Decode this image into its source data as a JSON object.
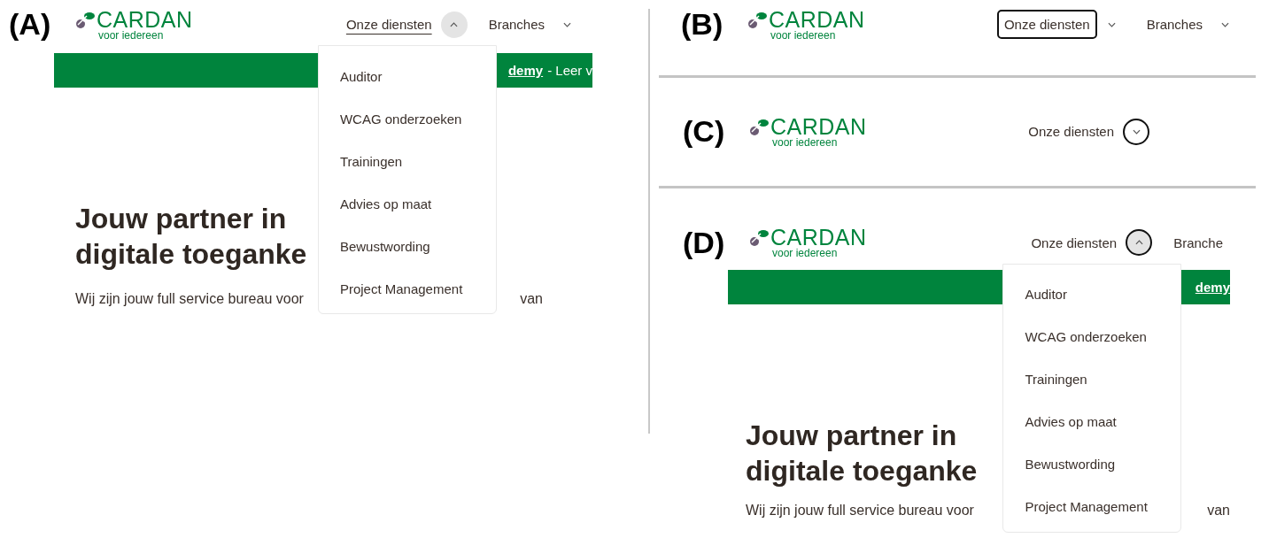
{
  "panels": [
    {
      "label": "(A)",
      "logo": {
        "name": "CARDAN",
        "tagline": "voor iedereen"
      },
      "nav": [
        {
          "label": "Onze diensten",
          "underlined": true,
          "expanded": true,
          "label_focused": false,
          "toggle_focused": false,
          "menu": [
            "Auditor",
            "WCAG onderzoeken",
            "Trainingen",
            "Advies op maat",
            "Bewustwording",
            "Project Management"
          ]
        },
        {
          "label": "Branches",
          "underlined": false,
          "expanded": false,
          "label_focused": false,
          "toggle_focused": false
        }
      ],
      "banner": {
        "link": "demy",
        "text": "- Leer v"
      },
      "hero": {
        "title_lines": [
          "Jouw partner in",
          "digitale toeganke"
        ],
        "intro_start": "Wij zijn jouw full service bureau voor",
        "intro_end": "van"
      }
    },
    {
      "label": "(B)",
      "logo": {
        "name": "CARDAN",
        "tagline": "voor iedereen"
      },
      "nav": [
        {
          "label": "Onze diensten",
          "underlined": false,
          "expanded": false,
          "label_focused": true,
          "toggle_focused": false
        },
        {
          "label": "Branches",
          "underlined": false,
          "expanded": false,
          "label_focused": false,
          "toggle_focused": false
        }
      ]
    },
    {
      "label": "(C)",
      "logo": {
        "name": "CARDAN",
        "tagline": "voor iedereen"
      },
      "nav": [
        {
          "label": "Onze diensten",
          "underlined": false,
          "expanded": false,
          "label_focused": false,
          "toggle_focused": true
        }
      ]
    },
    {
      "label": "(D)",
      "logo": {
        "name": "CARDAN",
        "tagline": "voor iedereen"
      },
      "nav": [
        {
          "label": "Onze diensten",
          "underlined": false,
          "expanded": true,
          "label_focused": false,
          "toggle_focused": true,
          "menu": [
            "Auditor",
            "WCAG onderzoeken",
            "Trainingen",
            "Advies op maat",
            "Bewustwording",
            "Project Management"
          ]
        },
        {
          "label": "Branche",
          "underlined": false,
          "label_focused": false
        }
      ],
      "banner": {
        "link": "demy"
      },
      "hero": {
        "title_lines": [
          "Jouw partner in",
          "digitale toeganke"
        ],
        "intro_start": "Wij zijn jouw full service bureau voor",
        "intro_end": "van"
      }
    }
  ]
}
